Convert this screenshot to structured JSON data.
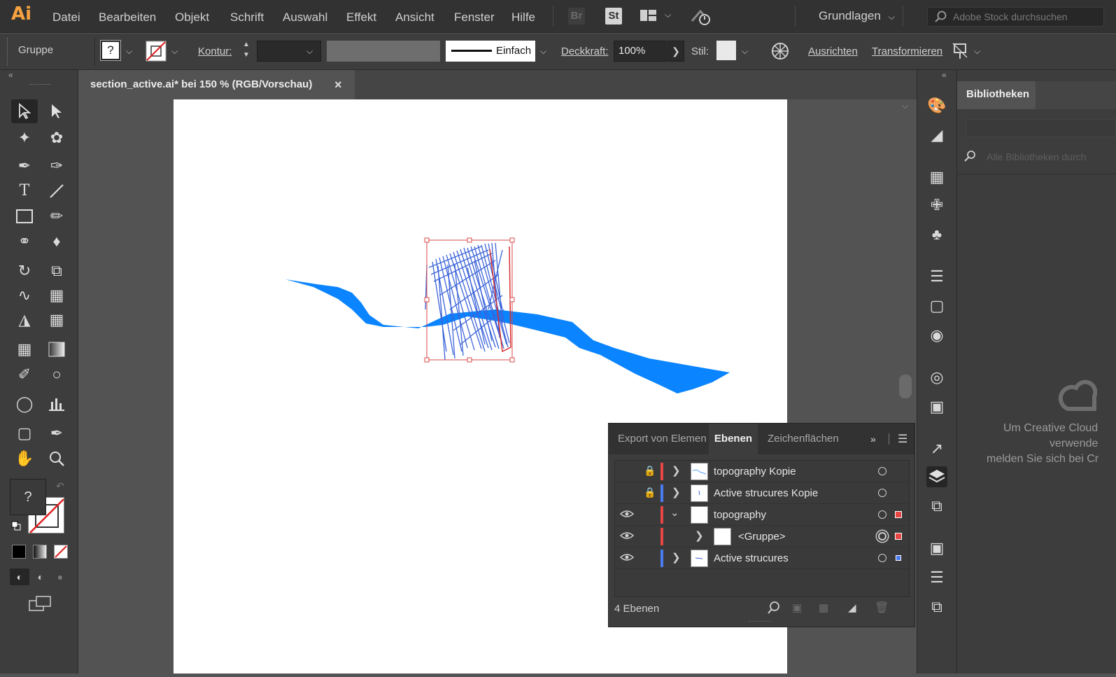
{
  "app": {
    "logo": "Ai"
  },
  "menu": {
    "items": [
      "Datei",
      "Bearbeiten",
      "Objekt",
      "Schrift",
      "Auswahl",
      "Effekt",
      "Ansicht",
      "Fenster",
      "Hilfe"
    ],
    "bridge": "Br",
    "stock": "St",
    "workspace": "Grundlagen",
    "search_placeholder": "Adobe Stock durchsuchen"
  },
  "control": {
    "selection": "Gruppe",
    "fill_unknown": "?",
    "stroke_label": "Kontur:",
    "stroke_style": "Einfach",
    "opacity_label": "Deckkraft:",
    "opacity_value": "100%",
    "style_label": "Stil:",
    "align_link": "Ausrichten",
    "transform_link": "Transformieren"
  },
  "document": {
    "tab_title": "section_active.ai* bei 150 % (RGB/Vorschau)",
    "close": "×"
  },
  "toolbar": {
    "fill_unknown": "?"
  },
  "libraries": {
    "tab": "Bibliotheken",
    "search_placeholder": "Alle Bibliotheken durch",
    "message_1": "Um Creative Cloud",
    "message_2": "verwende",
    "message_3": "melden Sie sich bei Cr"
  },
  "layers": {
    "tabs": [
      "Export von Elemen",
      "Ebenen",
      "Zeichenflächen"
    ],
    "rows": [
      {
        "name": "topography Kopie"
      },
      {
        "name": "Active strucures Kopie"
      },
      {
        "name": "topography"
      },
      {
        "name": "<Gruppe>"
      },
      {
        "name": "Active strucures"
      }
    ],
    "footer_count": "4 Ebenen"
  },
  "colors": {
    "accent_blue": "#0a84ff",
    "layer_red": "#e84545",
    "layer_blue": "#4a7bf0"
  }
}
